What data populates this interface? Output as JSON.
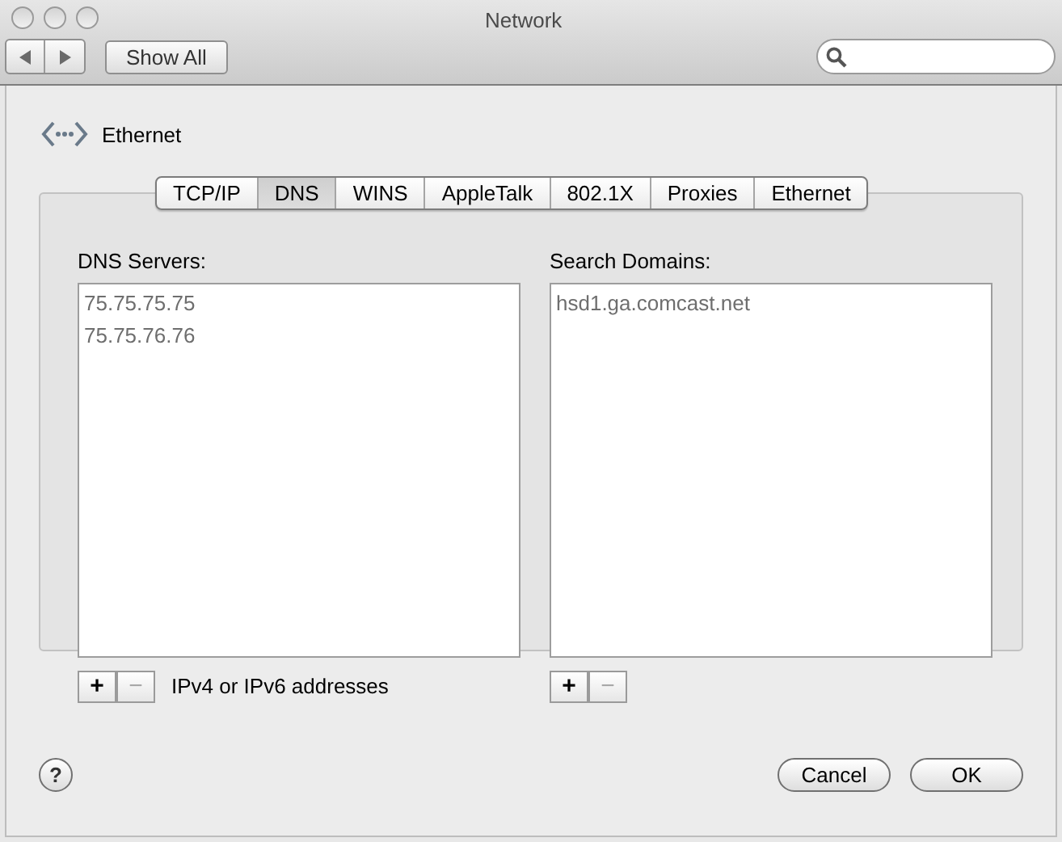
{
  "window": {
    "title": "Network"
  },
  "toolbar": {
    "show_all": "Show All"
  },
  "header": {
    "service": "Ethernet"
  },
  "tabs": [
    {
      "label": "TCP/IP",
      "selected": false
    },
    {
      "label": "DNS",
      "selected": true
    },
    {
      "label": "WINS",
      "selected": false
    },
    {
      "label": "AppleTalk",
      "selected": false
    },
    {
      "label": "802.1X",
      "selected": false
    },
    {
      "label": "Proxies",
      "selected": false
    },
    {
      "label": "Ethernet",
      "selected": false
    }
  ],
  "dns_servers": {
    "label": "DNS Servers:",
    "entries": [
      "75.75.75.75",
      "75.75.76.76"
    ],
    "hint": "IPv4 or IPv6 addresses",
    "add_button": {
      "label": "+",
      "disabled": false
    },
    "remove_button": {
      "label": "−",
      "disabled": true
    }
  },
  "search_domains": {
    "label": "Search Domains:",
    "entries": [
      "hsd1.ga.comcast.net"
    ],
    "add_button": {
      "label": "+",
      "disabled": false
    },
    "remove_button": {
      "label": "−",
      "disabled": true
    }
  },
  "help_button": "?",
  "buttons": [
    "Cancel",
    "OK"
  ]
}
